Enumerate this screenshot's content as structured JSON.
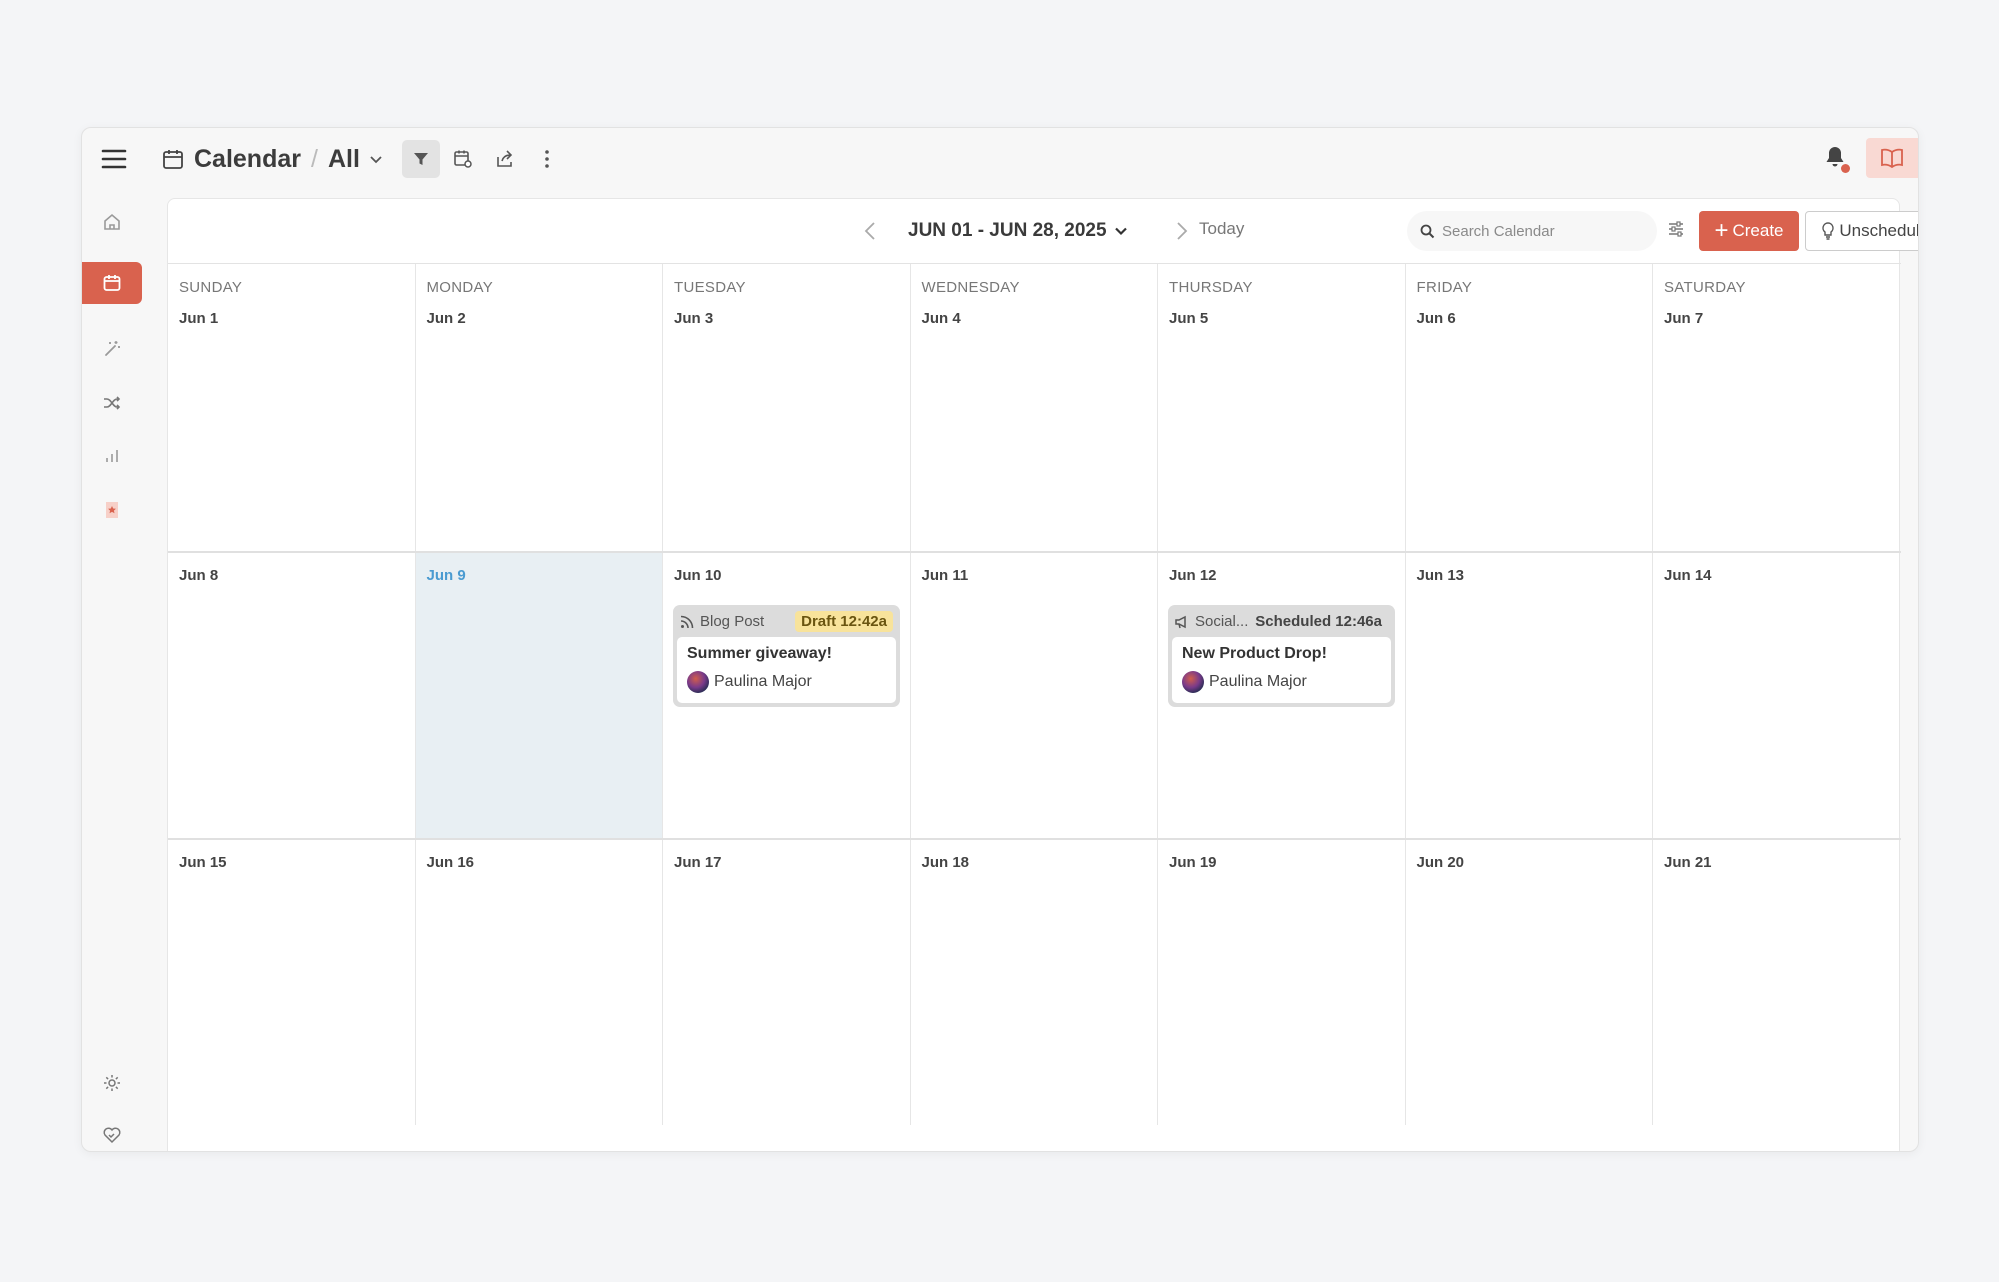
{
  "header": {
    "title": "Calendar",
    "separator": "/",
    "view": "All"
  },
  "sidebar": {
    "items": [
      {
        "name": "home",
        "icon": "home-icon"
      },
      {
        "name": "calendar",
        "icon": "calendar-icon",
        "active": true
      },
      {
        "name": "ideas",
        "icon": "magic-wand-icon"
      },
      {
        "name": "workflows",
        "icon": "shuffle-icon"
      },
      {
        "name": "analytics",
        "icon": "bar-chart-icon"
      },
      {
        "name": "brand",
        "icon": "star-flag-icon"
      }
    ],
    "bottom": [
      {
        "name": "settings",
        "icon": "gear-icon"
      },
      {
        "name": "support",
        "icon": "heart-handshake-icon"
      }
    ]
  },
  "toolbar": {
    "range_label": "JUN 01 - JUN 28, 2025",
    "today_label": "Today",
    "search_placeholder": "Search Calendar",
    "create_label": "Create",
    "unscheduled_label": "Unscheduled"
  },
  "colors": {
    "accent": "#d9624e",
    "today_bg": "#e8eff3",
    "today_text": "#4a9bd1",
    "draft_badge": "#f8e39b"
  },
  "weekdays": [
    "SUNDAY",
    "MONDAY",
    "TUESDAY",
    "WEDNESDAY",
    "THURSDAY",
    "FRIDAY",
    "SATURDAY"
  ],
  "weeks": [
    [
      "Jun 1",
      "Jun 2",
      "Jun 3",
      "Jun 4",
      "Jun 5",
      "Jun 6",
      "Jun 7"
    ],
    [
      "Jun 8",
      "Jun 9",
      "Jun 10",
      "Jun 11",
      "Jun 12",
      "Jun 13",
      "Jun 14"
    ],
    [
      "Jun 15",
      "Jun 16",
      "Jun 17",
      "Jun 18",
      "Jun 19",
      "Jun 20",
      "Jun 21"
    ]
  ],
  "today": "Jun 9",
  "events": [
    {
      "type": "Blog Post",
      "status": "Draft 12:42a",
      "title": "Summer giveaway!",
      "author": "Paulina Major"
    },
    {
      "type": "Social...",
      "status": "Scheduled 12:46a",
      "title": "New Product Drop!",
      "author": "Paulina Major"
    }
  ]
}
